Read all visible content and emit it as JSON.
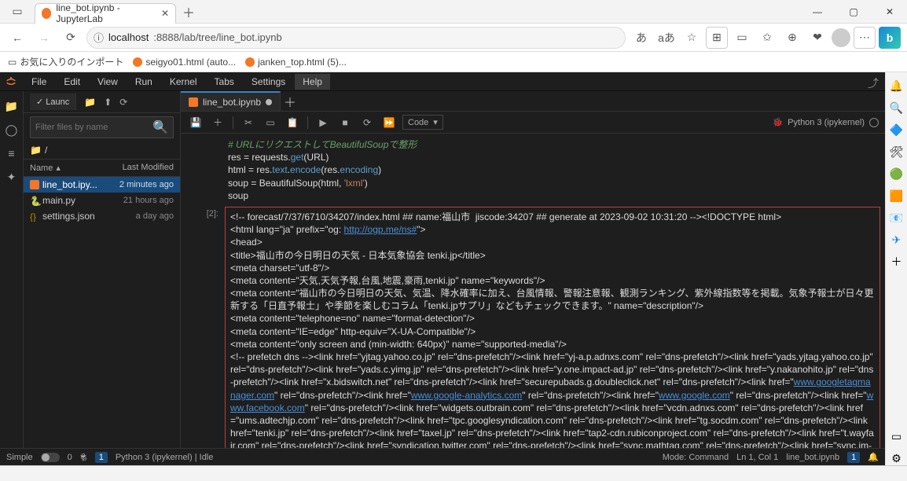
{
  "browser": {
    "tab_title": "line_bot.ipynb - JupyterLab",
    "url_prefix": "localhost",
    "url_rest": ":8888/lab/tree/line_bot.ipynb",
    "url_icon_label": "ⓘ",
    "aa": "あ",
    "aa2": "aあ"
  },
  "bookmarks": {
    "b1": "お気に入りのインポート",
    "b2": "seigyo01.html (auto...",
    "b3": "janken_top.html (5)..."
  },
  "menu": {
    "file": "File",
    "edit": "Edit",
    "view": "View",
    "run": "Run",
    "kernel": "Kernel",
    "tabs": "Tabs",
    "settings": "Settings",
    "help": "Help"
  },
  "filebrowser": {
    "tab": "✓ Launc",
    "filter_placeholder": "Filter files by name",
    "breadcrumb": "/",
    "header_name": "Name",
    "header_modified": "Last Modified",
    "files": [
      {
        "name": "line_bot.ipy...",
        "modified": "2 minutes ago",
        "type": "nb",
        "selected": true
      },
      {
        "name": "main.py",
        "modified": "21 hours ago",
        "type": "py",
        "selected": false
      },
      {
        "name": "settings.json",
        "modified": "a day ago",
        "type": "json",
        "selected": false
      }
    ]
  },
  "tabs": {
    "t1": "line_bot.ipynb"
  },
  "toolbar": {
    "celltype": "Code",
    "kernel": "Python 3 (ipykernel)"
  },
  "code_cell": {
    "comment": "# URLにリクエストしてBeautifulSoupで整形",
    "l1_a": "res = requests.",
    "l1_b": "get",
    "l1_c": "(URL)",
    "l2_a": "html = res.",
    "l2_b": "text",
    "l2_c": ".",
    "l2_d": "encode",
    "l2_e": "(res.",
    "l2_f": "encoding",
    "l2_g": ")",
    "l3_a": "soup = BeautifulSoup(html, ",
    "l3_b": "'lxml'",
    "l3_c": ")",
    "l4": "soup"
  },
  "output_prompt": "[2]:",
  "output": {
    "p1_a": "<!-- forecast/7/37/6710/34207/index.html ## name:福山市  jiscode:34207 ## generate at 2023-09-02 10:31:20 --><!DOCTYPE html>",
    "p2_a": "<html lang=\"ja\" prefix=\"og: ",
    "p2_link": "http://ogp.me/ns#",
    "p2_b": "\">",
    "p3": "<head>",
    "p4": "<title>福山市の今日明日の天気 - 日本気象協会 tenki.jp</title>",
    "p5": "<meta charset=\"utf-8\"/>",
    "p6": "<meta content=\"天気,天気予報,台風,地震,豪雨,tenki.jp\" name=\"keywords\"/>",
    "p7": "<meta content=\"福山市の今日明日の天気、気温、降水確率に加え、台風情報、警報注意報、観測ランキング、紫外線指数等を掲載。気象予報士が日々更新する「日直予報士」や季節を楽しむコラム「tenki.jpサプリ」などもチェックできます。\" name=\"description\"/>",
    "p8": "<meta content=\"telephone=no\" name=\"format-detection\"/>",
    "p9": "<meta content=\"IE=edge\" http-equiv=\"X-UA-Compatible\"/>",
    "p10": "<meta content=\"only screen and (min-width: 640px)\" name=\"supported-media\"/>",
    "p11_a": "<!-- prefetch dns --><link href=\"yjtag.yahoo.co.jp\" rel=\"dns-prefetch\"/><link href=\"yj-a.p.adnxs.com\" rel=\"dns-prefetch\"/><link href=\"yads.yjtag.yahoo.co.jp\" rel=\"dns-prefetch\"/><link href=\"yads.c.yimg.jp\" rel=\"dns-prefetch\"/><link href=\"y.one.impact-ad.jp\" rel=\"dns-prefetch\"/><link href=\"y.nakanohito.jp\" rel=\"dns-prefetch\"/><link href=\"x.bidswitch.net\" rel=\"dns-prefetch\"/><link href=\"securepubads.g.doubleclick.net\" rel=\"dns-prefetch\"/><link href=\"",
    "link1": "www.googletagmanager.com",
    "p11_b": "\" rel=\"dns-prefetch\"/><link href=\"",
    "link2": "www.google-analytics.com",
    "p11_c": "\" rel=\"dns-prefetch\"/><link href=\"",
    "link3": "www.google.com",
    "p11_d": "\" rel=\"dns-prefetch\"/><link href=\"",
    "link4": "www.facebook.com",
    "p11_e": "\" rel=\"dns-prefetch\"/><link href=\"widgets.outbrain.com\" rel=\"dns-prefetch\"/><link href=\"vcdn.adnxs.com\" rel=\"dns-prefetch\"/><link href=\"ums.adtechjp.com\" rel=\"dns-prefetch\"/><link href=\"tpc.googlesyndication.com\" rel=\"dns-prefetch\"/><link href=\"tg.socdm.com\" rel=\"dns-prefetch\"/><link href=\"tenki.jp\" rel=\"dns-prefetch\"/><link href=\"taxel.jp\" rel=\"dns-prefetch\"/><link href=\"tap2-cdn.rubiconproject.com\" rel=\"dns-prefetch\"/><link href=\"t.wayfair.com\" rel=\"dns-prefetch\"/><link href=\"syndication.twitter.com\" rel=\"dns-prefetch\"/><link href=\"sync.mathtag.com\" rel=\"dns-prefetch\"/><link href=\"sync.im-apps.net\" rel=\"dns-prefetch\"/><link href=\"sync.fout.jp\" rel=\"dns-prefetch\"/><link href=\"sync.ad-stir.com\" rel=\"dns-prefetch\"/><link href=\"stats.g.doubleclick.net\" rel=\"dns-prefetch\"/><link href=\"stats.aws.rubiconproject.com\" rel=\"dns-prefetch\"/><link href=\"staticxx.facebook.com\" rel=\"dns-pre"
  },
  "statusbar": {
    "simple": "Simple",
    "zero": "0",
    "gitnum": "1",
    "kernel": "Python 3 (ipykernel) | Idle",
    "mode": "Mode: Command",
    "lncol": "Ln 1, Col 1",
    "file": "line_bot.ipynb",
    "one": "1"
  }
}
